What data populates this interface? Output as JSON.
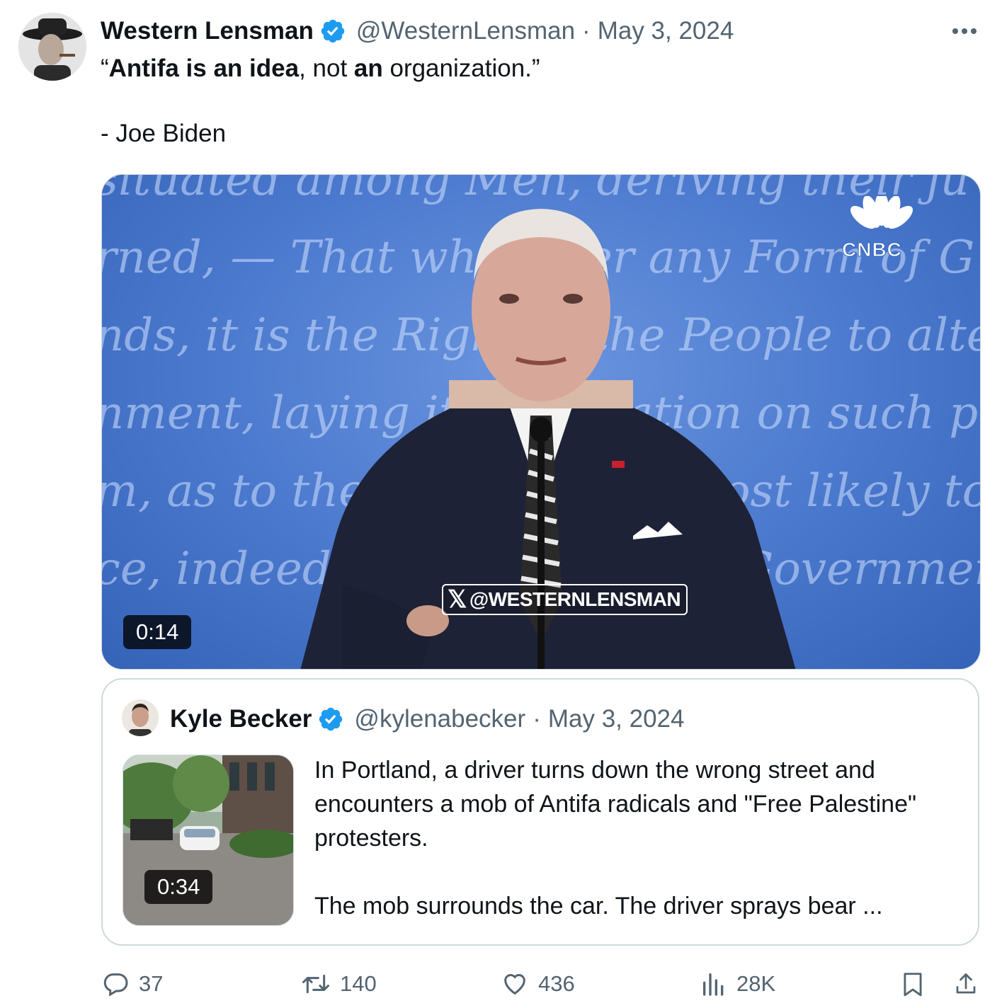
{
  "post": {
    "author": {
      "display_name": "Western Lensman",
      "handle": "@WesternLensman",
      "verified": true,
      "avatar_icon": "avatar-photo"
    },
    "separator": "·",
    "date": "May 3, 2024",
    "more_icon": "more-horizontal-icon",
    "text": {
      "quote_open": "“",
      "bold1": "Antifa is an idea",
      "plain1": ", not ",
      "bold2": "an",
      "plain2": " organization.”",
      "attribution": "- Joe Biden"
    },
    "video": {
      "duration": "0:14",
      "watermark": "@WESTERNLENSMAN",
      "network_logo": "CNBC",
      "background_script": [
        "situated among Men, deriving their ju",
        "rned, — That whenever any Form of G",
        "nds, it is the Right of the People to alter or",
        "nment, laying its foundation on such princ",
        "m, as to them shall seem most likely to effe",
        "ce, indeed, will dictate that Governmen"
      ]
    }
  },
  "quoted": {
    "author": {
      "display_name": "Kyle Becker",
      "handle": "@kylenabecker",
      "verified": true
    },
    "separator": "·",
    "date": "May 3, 2024",
    "video_duration": "0:34",
    "text_p1": "In Portland, a driver turns down the wrong street and encounters a mob of Antifa radicals and \"Free Palestine\" protesters.",
    "text_p2": "The mob surrounds the car. The driver sprays bear ..."
  },
  "actions": {
    "replies": "37",
    "reposts": "140",
    "likes": "436",
    "views": "28K",
    "reply_icon": "reply-icon",
    "repost_icon": "repost-icon",
    "like_icon": "heart-icon",
    "views_icon": "views-chart-icon",
    "bookmark_icon": "bookmark-icon",
    "share_icon": "share-icon"
  },
  "colors": {
    "text": "#0f1419",
    "secondary": "#536471",
    "verified": "#1d9bf0",
    "border": "#cfd9de",
    "debate_backdrop": "#4a78cd"
  }
}
